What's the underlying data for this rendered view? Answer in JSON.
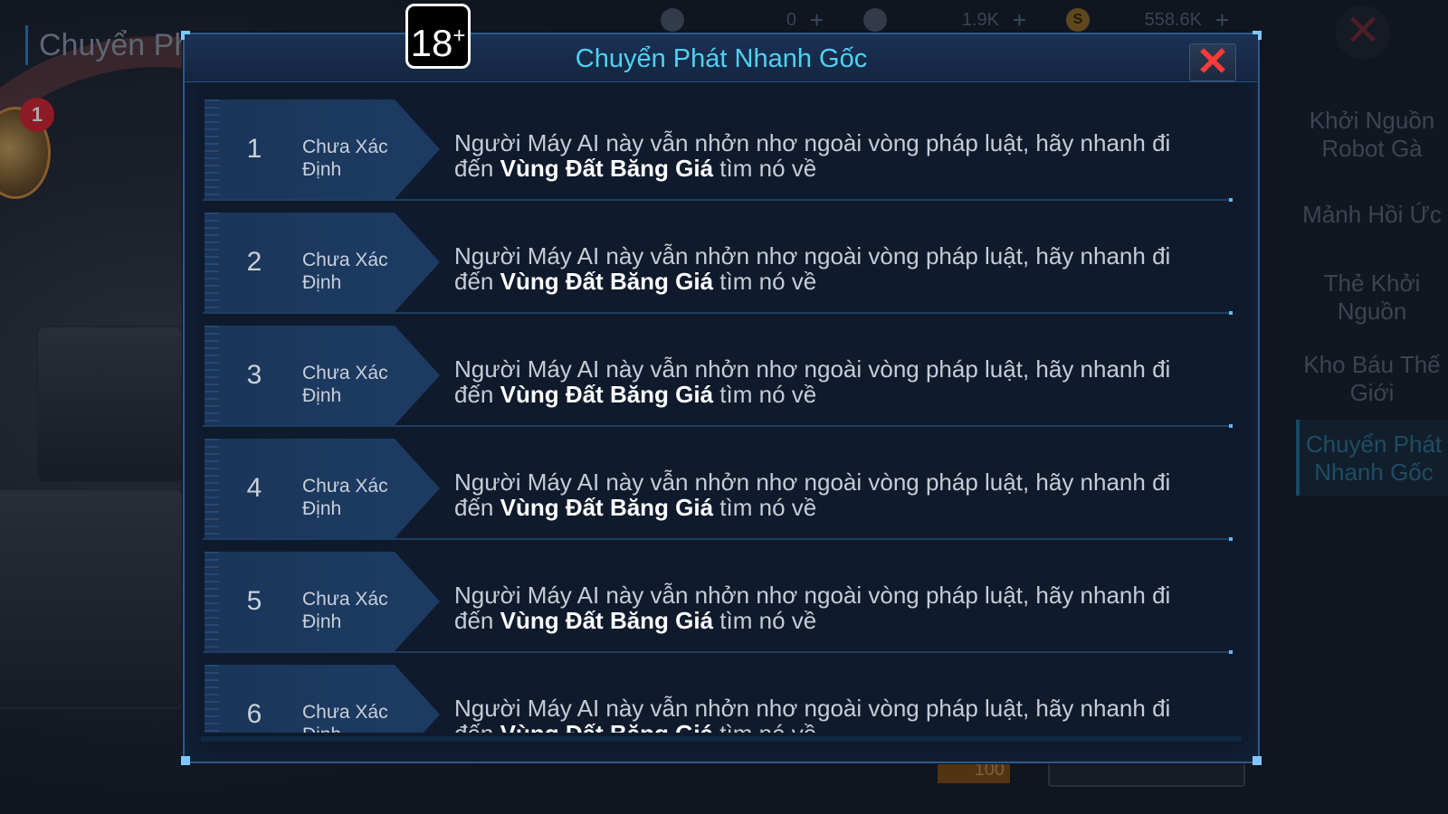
{
  "background": {
    "title": "Chuyển Ph",
    "event_badge": "1",
    "resources": [
      {
        "value": "0",
        "icon": "gem-icon"
      },
      {
        "value": "1.9K",
        "icon": "star-crystal-icon"
      },
      {
        "value": "558.6K",
        "icon": "coin-icon",
        "glyph": "S"
      }
    ],
    "plus_glyph": "+",
    "close_glyph": "✕",
    "side_nav": [
      {
        "label": "Khởi Nguồn Robot Gà"
      },
      {
        "label": "Mảnh Hồi Ức"
      },
      {
        "label": "Thẻ Khởi Nguồn"
      },
      {
        "label": "Kho Báu Thế Giới"
      },
      {
        "label": "Chuyển Phát Nhanh Gốc",
        "active": true
      }
    ],
    "bottom_price": "100"
  },
  "age_rating": {
    "number": "18",
    "suffix": "+"
  },
  "modal": {
    "title": "Chuyển Phát Nhanh Gốc",
    "close_glyph": "✕",
    "rows": [
      {
        "index": "1",
        "status": "Chưa Xác Định",
        "text_before": "Người Máy AI này vẫn nhởn nhơ ngoài vòng pháp luật, hãy nhanh đi đến ",
        "location": "Vùng Đất Băng Giá",
        "text_after": " tìm nó về"
      },
      {
        "index": "2",
        "status": "Chưa Xác Định",
        "text_before": "Người Máy AI này vẫn nhởn nhơ ngoài vòng pháp luật, hãy nhanh đi đến ",
        "location": "Vùng Đất Băng Giá",
        "text_after": " tìm nó về"
      },
      {
        "index": "3",
        "status": "Chưa Xác Định",
        "text_before": "Người Máy AI này vẫn nhởn nhơ ngoài vòng pháp luật, hãy nhanh đi đến ",
        "location": "Vùng Đất Băng Giá",
        "text_after": " tìm nó về"
      },
      {
        "index": "4",
        "status": "Chưa Xác Định",
        "text_before": "Người Máy AI này vẫn nhởn nhơ ngoài vòng pháp luật, hãy nhanh đi đến ",
        "location": "Vùng Đất Băng Giá",
        "text_after": " tìm nó về"
      },
      {
        "index": "5",
        "status": "Chưa Xác Định",
        "text_before": "Người Máy AI này vẫn nhởn nhơ ngoài vòng pháp luật, hãy nhanh đi đến ",
        "location": "Vùng Đất Băng Giá",
        "text_after": " tìm nó về"
      },
      {
        "index": "6",
        "status": "Chưa Xác Định",
        "text_before": "Người Máy AI này vẫn nhởn nhơ ngoài vòng pháp luật, hãy nhanh đi đến ",
        "location": "Vùng Đất Băng Giá",
        "text_after": " tìm nó về"
      }
    ]
  },
  "colors": {
    "title_cyan": "#4ed2f2",
    "close_red": "#ff3a3a",
    "panel_dark": "#0f1a2c",
    "tag_blue": "#1d3b62"
  }
}
